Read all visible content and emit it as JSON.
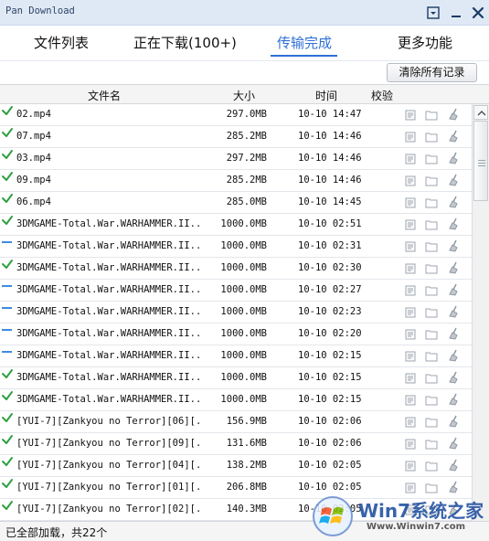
{
  "window": {
    "title": "Pan Download",
    "menu_icon": "dropdown-menu-icon",
    "minimize_icon": "minimize-icon",
    "close_icon": "close-icon"
  },
  "tabs": [
    {
      "label": "文件列表",
      "active": false
    },
    {
      "label": "正在下载(100+)",
      "active": false
    },
    {
      "label": "传输完成",
      "active": true
    },
    {
      "label": "更多功能",
      "active": false
    }
  ],
  "toolbar": {
    "clear_all_label": "清除所有记录"
  },
  "table": {
    "headers": {
      "name": "文件名",
      "size": "大小",
      "time": "时间",
      "verify": "校验"
    },
    "rows": [
      {
        "name": "02.mp4",
        "size": "297.0MB",
        "time": "10-10 14:47",
        "verify": "ok"
      },
      {
        "name": "07.mp4",
        "size": "285.2MB",
        "time": "10-10 14:46",
        "verify": "ok"
      },
      {
        "name": "03.mp4",
        "size": "297.2MB",
        "time": "10-10 14:46",
        "verify": "ok"
      },
      {
        "name": "09.mp4",
        "size": "285.2MB",
        "time": "10-10 14:46",
        "verify": "ok"
      },
      {
        "name": "06.mp4",
        "size": "285.0MB",
        "time": "10-10 14:45",
        "verify": "ok"
      },
      {
        "name": "3DMGAME-Total.War.WARHAMMER.II....",
        "size": "1000.0MB",
        "time": "10-10 02:51",
        "verify": "ok"
      },
      {
        "name": "3DMGAME-Total.War.WARHAMMER.II....",
        "size": "1000.0MB",
        "time": "10-10 02:31",
        "verify": "none"
      },
      {
        "name": "3DMGAME-Total.War.WARHAMMER.II....",
        "size": "1000.0MB",
        "time": "10-10 02:30",
        "verify": "ok"
      },
      {
        "name": "3DMGAME-Total.War.WARHAMMER.II....",
        "size": "1000.0MB",
        "time": "10-10 02:27",
        "verify": "none"
      },
      {
        "name": "3DMGAME-Total.War.WARHAMMER.II....",
        "size": "1000.0MB",
        "time": "10-10 02:23",
        "verify": "none"
      },
      {
        "name": "3DMGAME-Total.War.WARHAMMER.II....",
        "size": "1000.0MB",
        "time": "10-10 02:20",
        "verify": "none"
      },
      {
        "name": "3DMGAME-Total.War.WARHAMMER.II....",
        "size": "1000.0MB",
        "time": "10-10 02:15",
        "verify": "none"
      },
      {
        "name": "3DMGAME-Total.War.WARHAMMER.II....",
        "size": "1000.0MB",
        "time": "10-10 02:15",
        "verify": "ok"
      },
      {
        "name": "3DMGAME-Total.War.WARHAMMER.II....",
        "size": "1000.0MB",
        "time": "10-10 02:15",
        "verify": "ok"
      },
      {
        "name": "[YUI-7][Zankyou no Terror][06][...",
        "size": "156.9MB",
        "time": "10-10 02:06",
        "verify": "ok"
      },
      {
        "name": "[YUI-7][Zankyou no Terror][09][...",
        "size": "131.6MB",
        "time": "10-10 02:06",
        "verify": "ok"
      },
      {
        "name": "[YUI-7][Zankyou no Terror][04][...",
        "size": "138.2MB",
        "time": "10-10 02:05",
        "verify": "ok"
      },
      {
        "name": "[YUI-7][Zankyou no Terror][01][...",
        "size": "206.8MB",
        "time": "10-10 02:05",
        "verify": "ok"
      },
      {
        "name": "[YUI-7][Zankyou no Terror][02][...",
        "size": "140.3MB",
        "time": "10-10 02:05",
        "verify": "ok"
      }
    ]
  },
  "status": {
    "text": "已全部加载，共22个"
  },
  "watermark": {
    "brand": "Win7系统之家",
    "url": "Www.Winwin7.com"
  },
  "colors": {
    "accent": "#2f70d6",
    "verify_ok": "#2ea043",
    "verify_none": "#3f8be0",
    "titlebar": "#dfe9f6"
  }
}
